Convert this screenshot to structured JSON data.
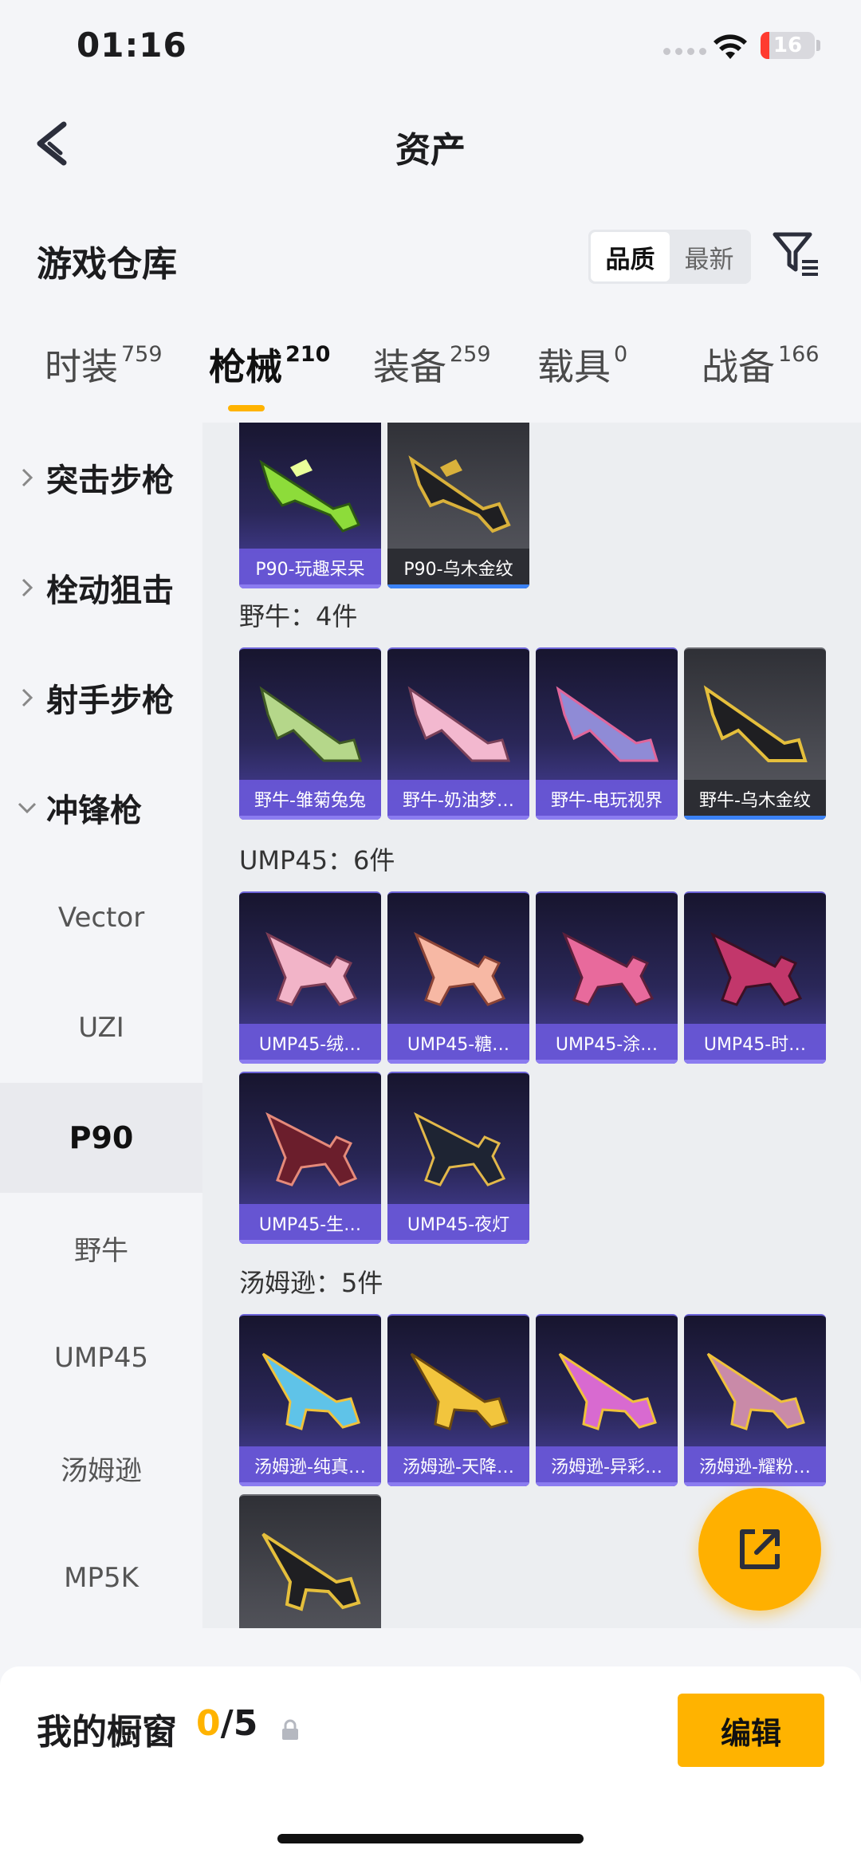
{
  "status_bar": {
    "time": "01:16",
    "battery": "16",
    "battery_level": 0.16
  },
  "nav": {
    "title": "资产"
  },
  "header": {
    "title": "游戏仓库",
    "sort_options": [
      "品质",
      "最新"
    ],
    "sort_selected": "品质"
  },
  "tabs": [
    {
      "label": "时装",
      "count": "759"
    },
    {
      "label": "枪械",
      "count": "210",
      "active": true
    },
    {
      "label": "装备",
      "count": "259"
    },
    {
      "label": "载具",
      "count": "0"
    },
    {
      "label": "战备",
      "count": "166"
    }
  ],
  "sidebar": {
    "groups": [
      "突击步枪",
      "栓动狙击",
      "射手步枪",
      "冲锋枪"
    ],
    "items": [
      "Vector",
      "UZI",
      "P90",
      "野牛",
      "UMP45",
      "汤姆逊",
      "MP5K"
    ],
    "active_item": "P90"
  },
  "content": {
    "p90_cards": [
      "P90-玩趣呆呆",
      "P90-乌木金纹"
    ],
    "sections": [
      {
        "title": "野牛：4件",
        "cards": [
          "野牛-雏菊兔兔",
          "野牛-奶油梦…",
          "野牛-电玩视界",
          "野牛-乌木金纹"
        ]
      },
      {
        "title": "UMP45：6件",
        "cards": [
          "UMP45-绒…",
          "UMP45-糖…",
          "UMP45-涂…",
          "UMP45-时…",
          "UMP45-生…",
          "UMP45-夜灯"
        ]
      },
      {
        "title": "汤姆逊：5件",
        "cards": [
          "汤姆逊-纯真…",
          "汤姆逊-天降…",
          "汤姆逊-异彩…",
          "汤姆逊-耀粉…",
          ""
        ]
      }
    ]
  },
  "bottom": {
    "showcase_label": "我的橱窗",
    "showcase_used": "0",
    "showcase_total": "/5",
    "edit_label": "编辑"
  }
}
